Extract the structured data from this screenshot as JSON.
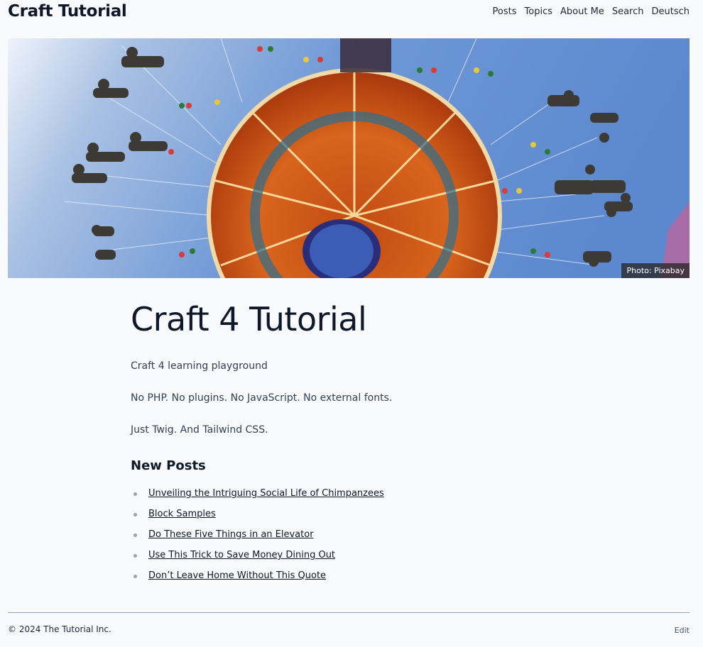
{
  "header": {
    "site_title": "Craft Tutorial",
    "nav": [
      "Posts",
      "Topics",
      "About Me",
      "Search",
      "Deutsch"
    ]
  },
  "hero": {
    "caption": "Photo: Pixabay"
  },
  "main": {
    "title": "Craft 4 Tutorial",
    "paragraphs": [
      "Craft 4 learning playground",
      "No PHP. No plugins. No JavaScript. No external fonts.",
      "Just Twig. And Tailwind CSS."
    ],
    "new_posts_heading": "New Posts",
    "posts": [
      "Unveiling the Intriguing Social Life of Chimpanzees",
      "Block Samples",
      "Do These Five Things in an Elevator",
      "Use This Trick to Save Money Dining Out",
      "Don’t Leave Home Without This Quote"
    ]
  },
  "footer": {
    "copyright": "© 2024 The Tutorial Inc.",
    "edit": "Edit"
  }
}
